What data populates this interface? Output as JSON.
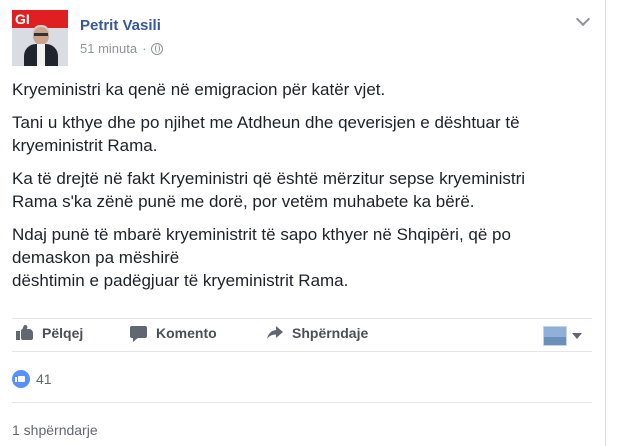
{
  "post": {
    "author": "Petrit Vasili",
    "time": "51 minuta",
    "time_separator": "·",
    "privacy_icon": "globe-icon",
    "avatar_text": "GI",
    "paragraphs": [
      [
        "Kryeministri ka qenë në emigracion për katër vjet."
      ],
      [
        "Tani u kthye dhe po njihet me Atdheun dhe qeverisjen e dështuar të",
        "kryeministrit Rama."
      ],
      [
        "Ka të drejtë në fakt Kryeministri që është mërzitur sepse kryeministri",
        "Rama s'ka zënë punë me dorë, por vetëm muhabete ka bërë."
      ],
      [
        "Ndaj punë të mbarë kryeministrit të sapo kthyer në Shqipëri, që po",
        "demaskon pa mëshirë",
        "dështimin e padëgjuar të kryeministrit Rama."
      ]
    ]
  },
  "actions": {
    "like_label": "Pëlqej",
    "comment_label": "Komento",
    "share_label": "Shpërndaje"
  },
  "stats": {
    "likes_count": "41",
    "shares_text": "1 shpërndarje"
  },
  "colors": {
    "author_link": "#365899",
    "meta_gray": "#90949c",
    "like_blue": "#5890ff",
    "action_gray": "#4b4f56"
  }
}
